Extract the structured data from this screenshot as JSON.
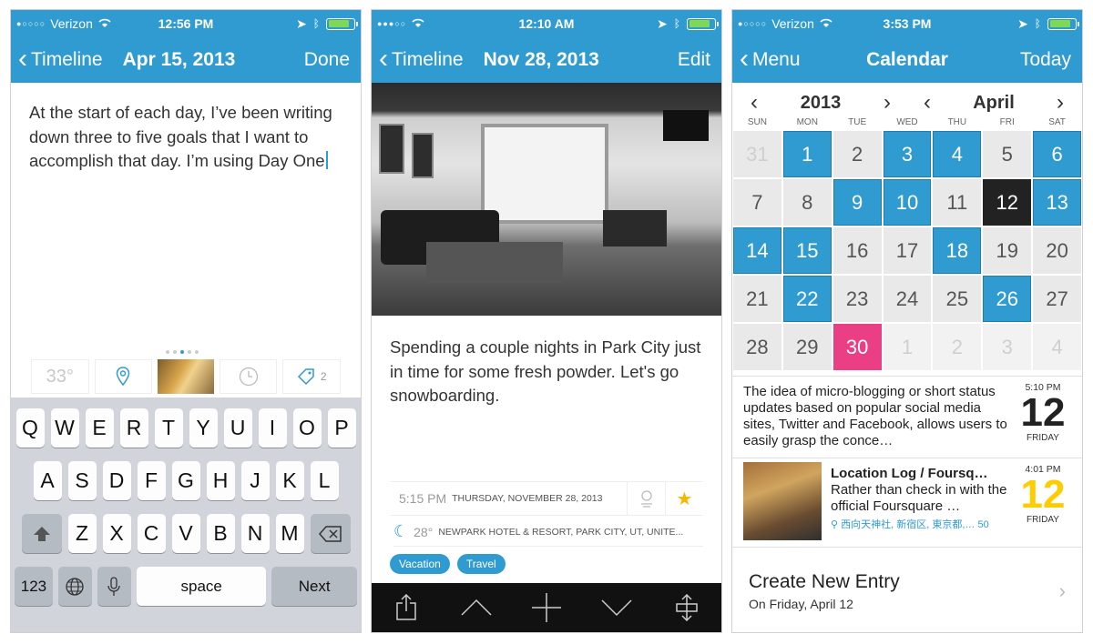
{
  "screen1": {
    "status": {
      "carrier": "Verizon",
      "time": "12:56 PM"
    },
    "nav": {
      "back": "Timeline",
      "title": "Apr 15, 2013",
      "action": "Done"
    },
    "editor_text": "At the start of each day, I’ve been writing down three to five goals that I want to accomplish that day. I’m using Day One",
    "toolbar": {
      "temperature": "33°",
      "tag_count": "2"
    },
    "keyboard": {
      "row1": [
        "Q",
        "W",
        "E",
        "R",
        "T",
        "Y",
        "U",
        "I",
        "O",
        "P"
      ],
      "row2": [
        "A",
        "S",
        "D",
        "F",
        "G",
        "H",
        "J",
        "K",
        "L"
      ],
      "row3": [
        "Z",
        "X",
        "C",
        "V",
        "B",
        "N",
        "M"
      ],
      "num_label": "123",
      "space_label": "space",
      "next_label": "Next"
    }
  },
  "screen2": {
    "status": {
      "time": "12:10 AM"
    },
    "nav": {
      "back": "Timeline",
      "title": "Nov 28, 2013",
      "action": "Edit"
    },
    "entry_text": "Spending a couple nights in Park City just in time for some fresh powder. Let's go snowboarding.",
    "meta": {
      "time": "5:15 PM",
      "date": "THURSDAY, NOVEMBER 28, 2013"
    },
    "weather": {
      "temp": "28°",
      "location": "NEWPARK HOTEL & RESORT, PARK CITY, UT, UNITE..."
    },
    "tags": [
      "Vacation",
      "Travel"
    ]
  },
  "screen3": {
    "status": {
      "carrier": "Verizon",
      "time": "3:53 PM"
    },
    "nav": {
      "back": "Menu",
      "title": "Calendar",
      "action": "Today"
    },
    "year": "2013",
    "month": "April",
    "weekdays": [
      "SUN",
      "MON",
      "TUE",
      "WED",
      "THU",
      "FRI",
      "SAT"
    ],
    "days": [
      {
        "n": "31",
        "s": "other"
      },
      {
        "n": "1",
        "s": "entry"
      },
      {
        "n": "2",
        "s": ""
      },
      {
        "n": "3",
        "s": "entry"
      },
      {
        "n": "4",
        "s": "entry"
      },
      {
        "n": "5",
        "s": ""
      },
      {
        "n": "6",
        "s": "entry"
      },
      {
        "n": "7",
        "s": ""
      },
      {
        "n": "8",
        "s": ""
      },
      {
        "n": "9",
        "s": "entry"
      },
      {
        "n": "10",
        "s": "entry"
      },
      {
        "n": "11",
        "s": ""
      },
      {
        "n": "12",
        "s": "selected"
      },
      {
        "n": "13",
        "s": "entry"
      },
      {
        "n": "14",
        "s": "entry"
      },
      {
        "n": "15",
        "s": "entry"
      },
      {
        "n": "16",
        "s": ""
      },
      {
        "n": "17",
        "s": ""
      },
      {
        "n": "18",
        "s": "entry"
      },
      {
        "n": "19",
        "s": ""
      },
      {
        "n": "20",
        "s": ""
      },
      {
        "n": "21",
        "s": ""
      },
      {
        "n": "22",
        "s": "entry"
      },
      {
        "n": "23",
        "s": ""
      },
      {
        "n": "24",
        "s": ""
      },
      {
        "n": "25",
        "s": ""
      },
      {
        "n": "26",
        "s": "entry"
      },
      {
        "n": "27",
        "s": ""
      },
      {
        "n": "28",
        "s": ""
      },
      {
        "n": "29",
        "s": ""
      },
      {
        "n": "30",
        "s": "today"
      },
      {
        "n": "1",
        "s": "other empty"
      },
      {
        "n": "2",
        "s": "other empty"
      },
      {
        "n": "3",
        "s": "other empty"
      },
      {
        "n": "4",
        "s": "other empty"
      }
    ],
    "entries": [
      {
        "text": "The idea of micro-blogging or short status updates based on popular social media sites, Twitter and Facebook, allows users to easily grasp the conce…",
        "time": "5:10 PM",
        "day": "12",
        "weekday": "FRIDAY"
      },
      {
        "title": "Location Log / Foursq…",
        "text": "Rather than check in with the official Foursquare …",
        "location": "西向天神社, 新宿区, 東京都,… 50",
        "time": "4:01 PM",
        "day": "12",
        "weekday": "FRIDAY"
      }
    ],
    "create": {
      "title": "Create New Entry",
      "subtitle": "On Friday, April 12"
    }
  },
  "colors": {
    "accent": "#2f9bd1",
    "today": "#ea3f85",
    "selected": "#222222",
    "star": "#f5b800",
    "yellow_day": "#ffcc00"
  }
}
